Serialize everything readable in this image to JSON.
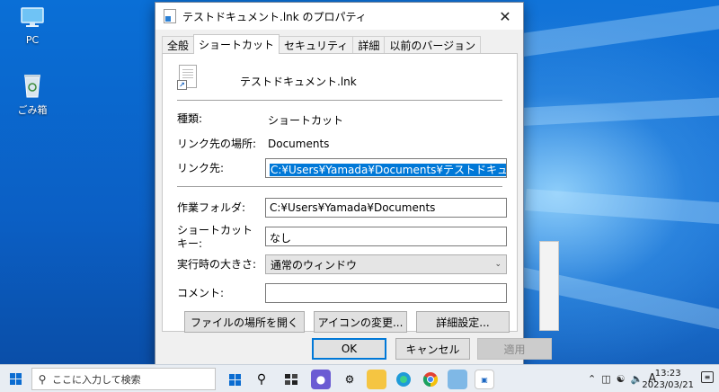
{
  "desktop": {
    "icons": [
      {
        "label": "PC",
        "icon": "monitor-icon"
      },
      {
        "label": "ごみ箱",
        "icon": "recycle-bin-icon"
      }
    ]
  },
  "dialog": {
    "title": "テストドキュメント.lnk のプロパティ",
    "tabs": [
      "全般",
      "ショートカット",
      "セキュリティ",
      "詳細",
      "以前のバージョン"
    ],
    "active_tab": "ショートカット",
    "file_name": "テストドキュメント.lnk",
    "type_label": "種類:",
    "type_value": "ショートカット",
    "location_label": "リンク先の場所:",
    "location_value": "Documents",
    "target_label": "リンク先:",
    "target_value": "C:¥Users¥Yamada¥Documents¥テストドキュメント.txt",
    "start_in_label": "作業フォルダ:",
    "start_in_value": "C:¥Users¥Yamada¥Documents",
    "shortcut_key_label_1": "ショートカット",
    "shortcut_key_label_2": "キー:",
    "shortcut_key_value": "なし",
    "run_label": "実行時の大きさ:",
    "run_value": "通常のウィンドウ",
    "comment_label": "コメント:",
    "comment_value": "",
    "open_location_button": "ファイルの場所を開く",
    "change_icon_button": "アイコンの変更...",
    "advanced_button": "詳細設定...",
    "ok_button": "OK",
    "cancel_button": "キャンセル",
    "apply_button": "適用"
  },
  "taskbar": {
    "search_placeholder": "ここに入力して検索",
    "ime": "A",
    "time": "13:23",
    "date": "2023/03/21"
  },
  "colors": {
    "selection": "#0078d7",
    "desktop_blue": "#0b5fc4"
  }
}
